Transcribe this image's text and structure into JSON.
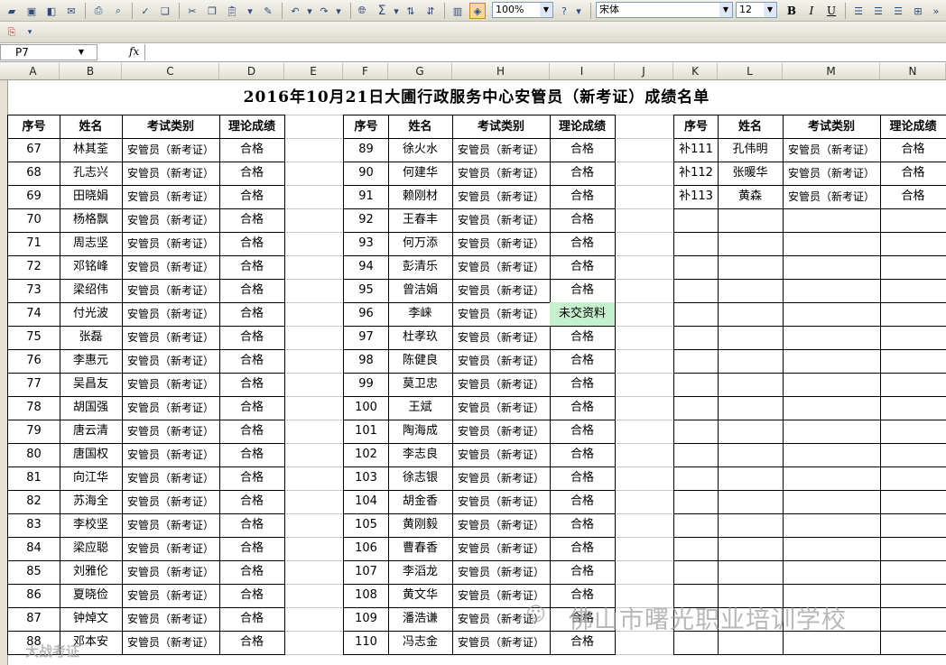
{
  "toolbar": {
    "zoom": "100%",
    "font": "宋体",
    "font_size": "12",
    "bold_label": "B",
    "italic_label": "I",
    "underline_label": "U",
    "sum_label": "Σ"
  },
  "formula_bar": {
    "name_box": "P7",
    "fx_label": "fx",
    "content": ""
  },
  "columns": [
    "A",
    "B",
    "C",
    "D",
    "E",
    "F",
    "G",
    "H",
    "I",
    "J",
    "K",
    "L",
    "M",
    "N"
  ],
  "sheet": {
    "title": "2016年10月21日大圃行政服务中心安管员（新考证）成绩名单",
    "headers": [
      "序号",
      "姓名",
      "考试类别",
      "理论成绩"
    ],
    "block1": [
      [
        "67",
        "林其荃",
        "安管员（新考证）",
        "合格"
      ],
      [
        "68",
        "孔志兴",
        "安管员（新考证）",
        "合格"
      ],
      [
        "69",
        "田晓娟",
        "安管员（新考证）",
        "合格"
      ],
      [
        "70",
        "杨格飘",
        "安管员（新考证）",
        "合格"
      ],
      [
        "71",
        "周志坚",
        "安管员（新考证）",
        "合格"
      ],
      [
        "72",
        "邓铭峰",
        "安管员（新考证）",
        "合格"
      ],
      [
        "73",
        "梁绍伟",
        "安管员（新考证）",
        "合格"
      ],
      [
        "74",
        "付光波",
        "安管员（新考证）",
        "合格"
      ],
      [
        "75",
        "张磊",
        "安管员（新考证）",
        "合格"
      ],
      [
        "76",
        "李惠元",
        "安管员（新考证）",
        "合格"
      ],
      [
        "77",
        "吴昌友",
        "安管员（新考证）",
        "合格"
      ],
      [
        "78",
        "胡国强",
        "安管员（新考证）",
        "合格"
      ],
      [
        "79",
        "唐云清",
        "安管员（新考证）",
        "合格"
      ],
      [
        "80",
        "唐国权",
        "安管员（新考证）",
        "合格"
      ],
      [
        "81",
        "向江华",
        "安管员（新考证）",
        "合格"
      ],
      [
        "82",
        "苏海全",
        "安管员（新考证）",
        "合格"
      ],
      [
        "83",
        "李校坚",
        "安管员（新考证）",
        "合格"
      ],
      [
        "84",
        "梁应聪",
        "安管员（新考证）",
        "合格"
      ],
      [
        "85",
        "刘雅伦",
        "安管员（新考证）",
        "合格"
      ],
      [
        "86",
        "夏晓俭",
        "安管员（新考证）",
        "合格"
      ],
      [
        "87",
        "钟焯文",
        "安管员（新考证）",
        "合格"
      ],
      [
        "88",
        "邓本安",
        "安管员（新考证）",
        "合格"
      ]
    ],
    "block2": [
      [
        "89",
        "徐火水",
        "安管员（新考证）",
        "合格"
      ],
      [
        "90",
        "何建华",
        "安管员（新考证）",
        "合格"
      ],
      [
        "91",
        "赖刚材",
        "安管员（新考证）",
        "合格"
      ],
      [
        "92",
        "王春丰",
        "安管员（新考证）",
        "合格"
      ],
      [
        "93",
        "何万添",
        "安管员（新考证）",
        "合格"
      ],
      [
        "94",
        "彭清乐",
        "安管员（新考证）",
        "合格"
      ],
      [
        "95",
        "曾洁娟",
        "安管员（新考证）",
        "合格"
      ],
      [
        "96",
        "李崃",
        "安管员（新考证）",
        "未交资料"
      ],
      [
        "97",
        "杜孝玖",
        "安管员（新考证）",
        "合格"
      ],
      [
        "98",
        "陈健良",
        "安管员（新考证）",
        "合格"
      ],
      [
        "99",
        "莫卫忠",
        "安管员（新考证）",
        "合格"
      ],
      [
        "100",
        "王斌",
        "安管员（新考证）",
        "合格"
      ],
      [
        "101",
        "陶海成",
        "安管员（新考证）",
        "合格"
      ],
      [
        "102",
        "李志良",
        "安管员（新考证）",
        "合格"
      ],
      [
        "103",
        "徐志银",
        "安管员（新考证）",
        "合格"
      ],
      [
        "104",
        "胡金香",
        "安管员（新考证）",
        "合格"
      ],
      [
        "105",
        "黄刚毅",
        "安管员（新考证）",
        "合格"
      ],
      [
        "106",
        "曹春香",
        "安管员（新考证）",
        "合格"
      ],
      [
        "107",
        "李滔龙",
        "安管员（新考证）",
        "合格"
      ],
      [
        "108",
        "黄文华",
        "安管员（新考证）",
        "合格"
      ],
      [
        "109",
        "潘浩谦",
        "安管员（新考证）",
        "合格"
      ],
      [
        "110",
        "冯志金",
        "安管员（新考证）",
        "合格"
      ]
    ],
    "block3": [
      [
        "补111",
        "孔伟明",
        "安管员（新考证）",
        "合格"
      ],
      [
        "补112",
        "张暖华",
        "安管员（新考证）",
        "合格"
      ],
      [
        "补113",
        "黄森",
        "安管员（新考证）",
        "合格"
      ]
    ],
    "highlight_color": "#c6efce"
  },
  "watermark": {
    "main": "佛山市曙光职业培训学校",
    "corner": "大战考证"
  }
}
